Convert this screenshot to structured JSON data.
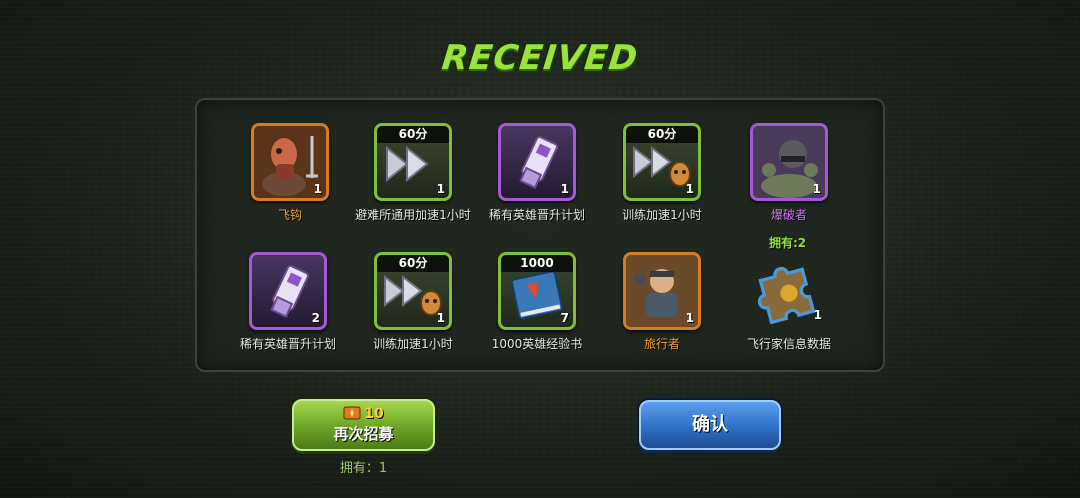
{
  "title": "RECEIVED",
  "items": [
    {
      "name": "飞钩",
      "count": "1",
      "tag": "",
      "rarity": "orange",
      "icon": "grappling-hook-hero-icon"
    },
    {
      "name": "避难所通用加速1小时",
      "count": "1",
      "tag": "60分",
      "rarity": "green",
      "icon": "speedup-arrows-icon"
    },
    {
      "name": "稀有英雄晋升计划",
      "count": "1",
      "tag": "",
      "rarity": "purple",
      "icon": "usb-drive-icon"
    },
    {
      "name": "训练加速1小时",
      "count": "1",
      "tag": "60分",
      "rarity": "green",
      "icon": "training-speedup-icon"
    },
    {
      "name": "爆破者",
      "count": "1",
      "tag": "",
      "rarity": "purple",
      "icon": "demolisher-hero-icon",
      "owned": "拥有:2"
    },
    {
      "name": "稀有英雄晋升计划",
      "count": "2",
      "tag": "",
      "rarity": "purple",
      "icon": "usb-drive-icon"
    },
    {
      "name": "训练加速1小时",
      "count": "1",
      "tag": "60分",
      "rarity": "green",
      "icon": "training-speedup-icon"
    },
    {
      "name": "1000英雄经验书",
      "count": "7",
      "tag": "1000",
      "rarity": "green",
      "icon": "exp-book-icon"
    },
    {
      "name": "旅行者",
      "count": "1",
      "tag": "",
      "rarity": "orange",
      "icon": "traveler-hero-icon"
    },
    {
      "name": "飞行家信息数据",
      "count": "1",
      "tag": "",
      "rarity": "none",
      "icon": "puzzle-piece-icon"
    }
  ],
  "buttons": {
    "recruit_cost": "10",
    "recruit_label": "再次招募",
    "confirm_label": "确认"
  },
  "owned_bottom": "拥有：1",
  "colors": {
    "title": "#9be33a",
    "rarity_orange": "#d67d22",
    "rarity_purple": "#a45ad6",
    "rarity_green": "#7fbf3a",
    "confirm_blue": "#2f6fc8",
    "recruit_green": "#6fa828"
  }
}
